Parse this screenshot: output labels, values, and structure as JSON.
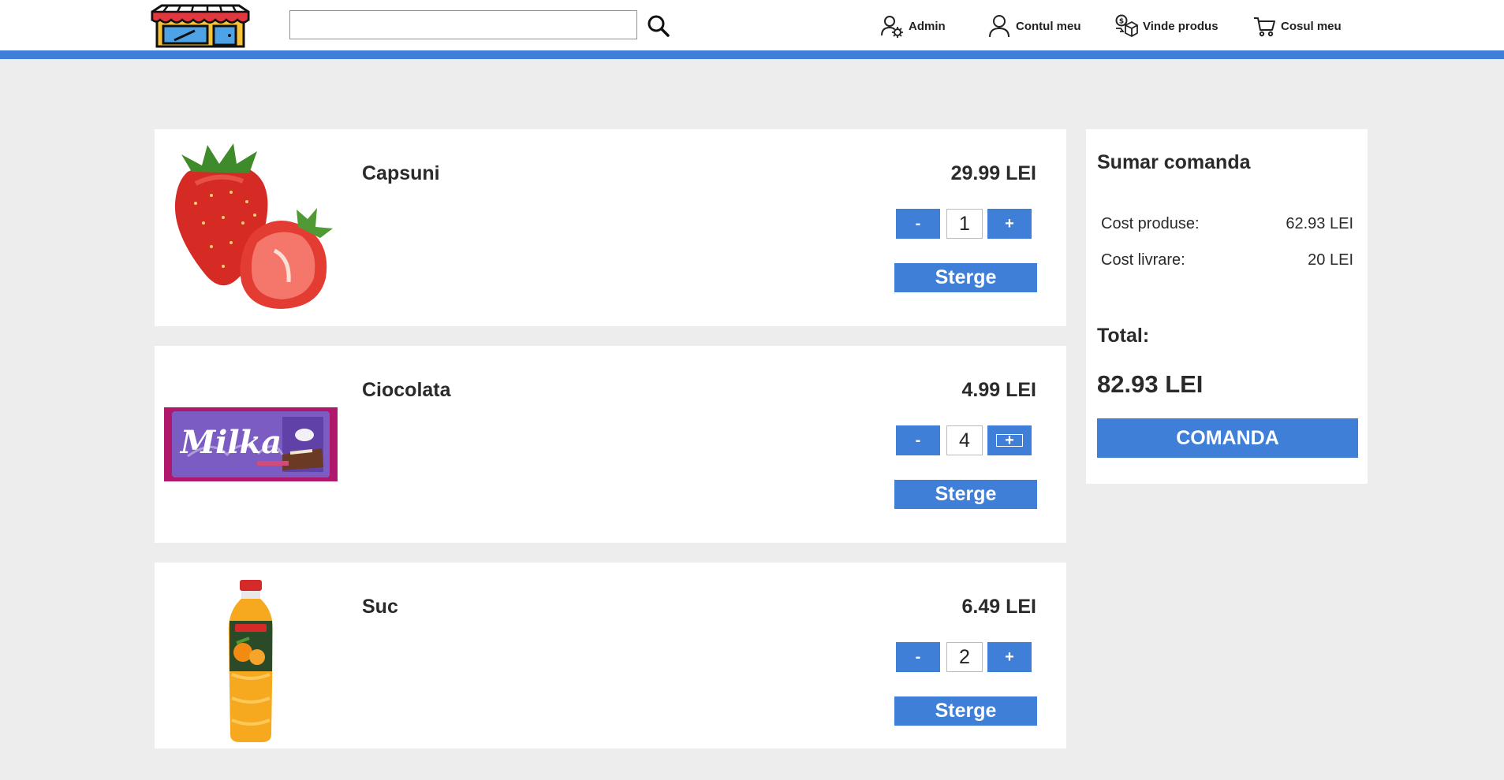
{
  "header": {
    "search": {
      "value": "",
      "placeholder": ""
    },
    "nav": [
      {
        "label": "Admin",
        "icon": "admin-user-gear-icon"
      },
      {
        "label": "Contul meu",
        "icon": "user-icon"
      },
      {
        "label": "Vinde produs",
        "icon": "sell-money-box-icon"
      },
      {
        "label": "Cosul meu",
        "icon": "cart-icon"
      }
    ]
  },
  "cart": {
    "items": [
      {
        "name": "Capsuni",
        "price": "29.99 LEI",
        "quantity": "1",
        "image": "strawberries",
        "minus": "-",
        "plus": "+",
        "remove": "Sterge"
      },
      {
        "name": "Ciocolata",
        "price": "4.99 LEI",
        "quantity": "4",
        "image": "milka-chocolate",
        "image_text": "Milka",
        "minus": "-",
        "plus": "+",
        "remove": "Sterge"
      },
      {
        "name": "Suc",
        "price": "6.49 LEI",
        "quantity": "2",
        "image": "orange-juice-bottle",
        "minus": "-",
        "plus": "+",
        "remove": "Sterge"
      }
    ]
  },
  "summary": {
    "title": "Sumar comanda",
    "products_label": "Cost produse:",
    "products_value": "62.93 LEI",
    "delivery_label": "Cost livrare:",
    "delivery_value": "20 LEI",
    "total_label": "Total:",
    "total_value": "82.93 LEI",
    "order_button": "COMANDA"
  },
  "colors": {
    "accent": "#3f7fd8",
    "background": "#ededed",
    "card": "#ffffff"
  }
}
